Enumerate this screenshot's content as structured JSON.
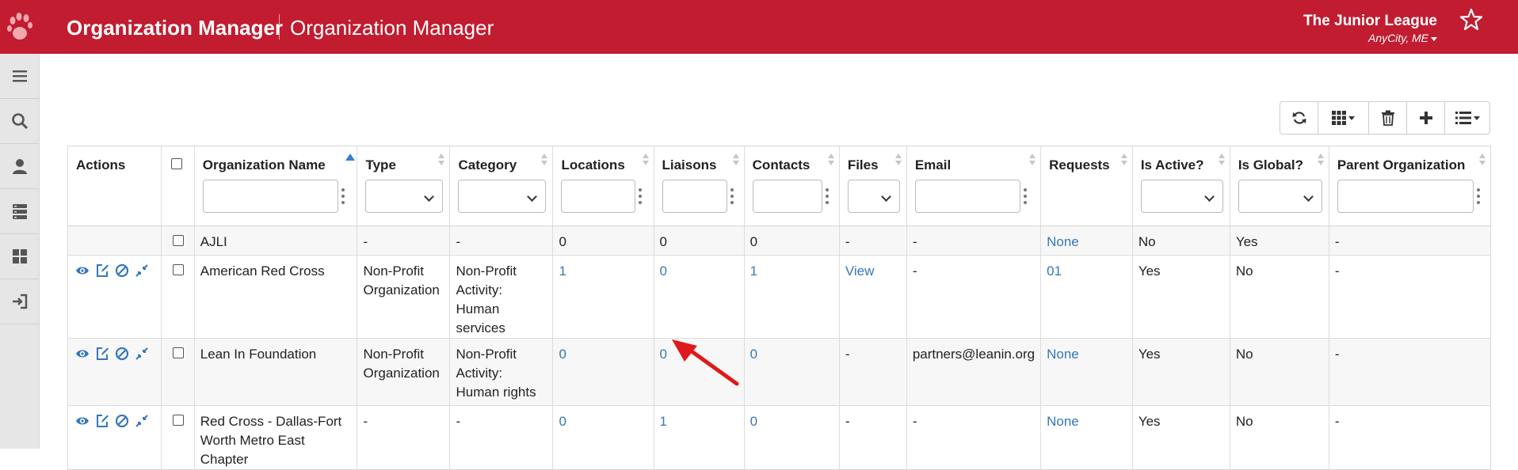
{
  "header": {
    "app_title": "Organization Manager",
    "page_title": "Organization Manager",
    "org_name": "The Junior League",
    "org_location": "AnyCity, ME",
    "logo_icon": "paw-icon",
    "favorite_icon": "star-icon",
    "bg_color": "#c11c30"
  },
  "sidebar": {
    "items": [
      {
        "icon": "menu-icon"
      },
      {
        "icon": "search-icon"
      },
      {
        "icon": "user-icon"
      },
      {
        "icon": "server-icon"
      },
      {
        "icon": "dashboard-icon"
      },
      {
        "icon": "sign-out-icon"
      }
    ]
  },
  "toolbar": {
    "buttons": [
      "refresh-icon",
      "columns-icon",
      "trash-icon",
      "plus-icon",
      "list-icon"
    ]
  },
  "table": {
    "columns": [
      {
        "label": "Actions"
      },
      {
        "label": ""
      },
      {
        "label": "Organization Name"
      },
      {
        "label": "Type"
      },
      {
        "label": "Category"
      },
      {
        "label": "Locations"
      },
      {
        "label": "Liaisons"
      },
      {
        "label": "Contacts"
      },
      {
        "label": "Files"
      },
      {
        "label": "Email"
      },
      {
        "label": "Requests"
      },
      {
        "label": "Is Active?"
      },
      {
        "label": "Is Global?"
      },
      {
        "label": "Parent Organization"
      }
    ],
    "rows": [
      {
        "name": "AJLI",
        "type": "-",
        "category": "-",
        "locations": "0",
        "liaisons": "0",
        "contacts": "0",
        "files": "-",
        "email": "-",
        "requests": "None",
        "is_active": "No",
        "is_global": "Yes",
        "parent": "-"
      },
      {
        "name": "American Red Cross",
        "type": "Non-Profit Organization",
        "category": "Non-Profit Activity: Human services",
        "locations": "1",
        "liaisons": "0",
        "contacts": "1",
        "files": "View",
        "email": "-",
        "requests": "01",
        "is_active": "Yes",
        "is_global": "No",
        "parent": "-"
      },
      {
        "name": "Lean In Foundation",
        "type": "Non-Profit Organization",
        "category": "Non-Profit Activity: Human rights",
        "locations": "0",
        "liaisons": "0",
        "contacts": "0",
        "files": "-",
        "email": "partners@leanin.org",
        "requests": "None",
        "is_active": "Yes",
        "is_global": "No",
        "parent": "-"
      },
      {
        "name": "Red Cross - Dallas-Fort Worth Metro East Chapter",
        "type": "-",
        "category": "-",
        "locations": "0",
        "liaisons": "1",
        "contacts": "0",
        "files": "-",
        "email": "-",
        "requests": "None",
        "is_active": "Yes",
        "is_global": "No",
        "parent": "-"
      }
    ],
    "action_icons": [
      "view-icon",
      "edit-icon",
      "deactivate-icon",
      "merge-icon"
    ]
  },
  "annotation": {
    "arrow_color": "#e0191c"
  }
}
